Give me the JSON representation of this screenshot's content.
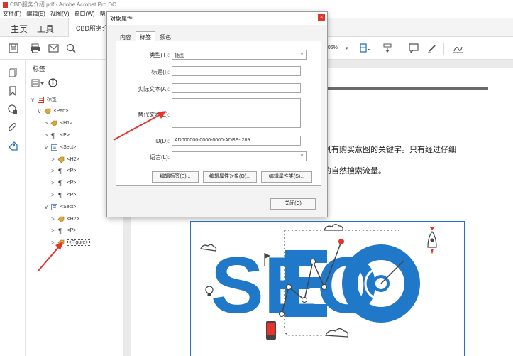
{
  "window": {
    "title": "CBD服务介绍.pdf - Adobe Acrobat Pro DC"
  },
  "menu": [
    "文件(F)",
    "编辑(E)",
    "视图(V)",
    "窗口(W)",
    "帮助"
  ],
  "tabs": {
    "home": "主页",
    "tools": "工具",
    "document": "CBD服务介绍"
  },
  "toolbar": {
    "zoom": "106%"
  },
  "tags_panel": {
    "title": "标签",
    "tree": [
      {
        "label": "标签",
        "icon": "tags-root-icon",
        "chevron": "∨",
        "indent": 0
      },
      {
        "label": "<Part>",
        "icon": "tag-icon",
        "chevron": "∨",
        "indent": 1
      },
      {
        "label": "<H1>",
        "icon": "tag-icon",
        "chevron": ">",
        "indent": 2
      },
      {
        "label": "<P>",
        "icon": "paragraph-icon",
        "chevron": ">",
        "indent": 2
      },
      {
        "label": "<Sect>",
        "icon": "section-icon",
        "chevron": "∨",
        "indent": 2
      },
      {
        "label": "<H2>",
        "icon": "tag-icon",
        "chevron": ">",
        "indent": 3
      },
      {
        "label": "<P>",
        "icon": "paragraph-icon",
        "chevron": ">",
        "indent": 3
      },
      {
        "label": "<P>",
        "icon": "paragraph-icon",
        "chevron": ">",
        "indent": 3
      },
      {
        "label": "<P>",
        "icon": "paragraph-icon",
        "chevron": ">",
        "indent": 3
      },
      {
        "label": "<Sect>",
        "icon": "section-icon",
        "chevron": "∨",
        "indent": 2
      },
      {
        "label": "<H2>",
        "icon": "tag-icon",
        "chevron": ">",
        "indent": 3
      },
      {
        "label": "<P>",
        "icon": "paragraph-icon",
        "chevron": ">",
        "indent": 3
      },
      {
        "label": "<Figure>",
        "icon": "tag-icon",
        "chevron": ">",
        "indent": 3,
        "selected": true
      }
    ]
  },
  "document": {
    "line1": "具有购买意图的关键字。只有经过仔细",
    "line2": "的自然搜索流量。",
    "seo_text": "SEO"
  },
  "dialog": {
    "title": "对象属性",
    "tabs": [
      "内容",
      "标签",
      "颜色"
    ],
    "active_tab": "标签",
    "fields": {
      "type_label": "类型(T):",
      "type_value": "插图",
      "title_label": "标题(I):",
      "title_value": "",
      "actual_text_label": "实际文本(A):",
      "actual_text_value": "",
      "alt_text_label": "替代文本(E):",
      "alt_text_value": "",
      "id_label": "ID(D):",
      "id_value": "AD000000-0000-0000-ADBE-       289",
      "language_label": "语言(L):",
      "language_value": ""
    },
    "buttons": {
      "edit_tag": "编辑标签(E)...",
      "edit_attr_obj": "编辑属性对象(O)...",
      "edit_attr_class": "编辑属性类(S)...",
      "close": "关闭(C)"
    }
  },
  "colors": {
    "seo_blue": "#1f78c8",
    "annotation_red": "#e8322a"
  }
}
